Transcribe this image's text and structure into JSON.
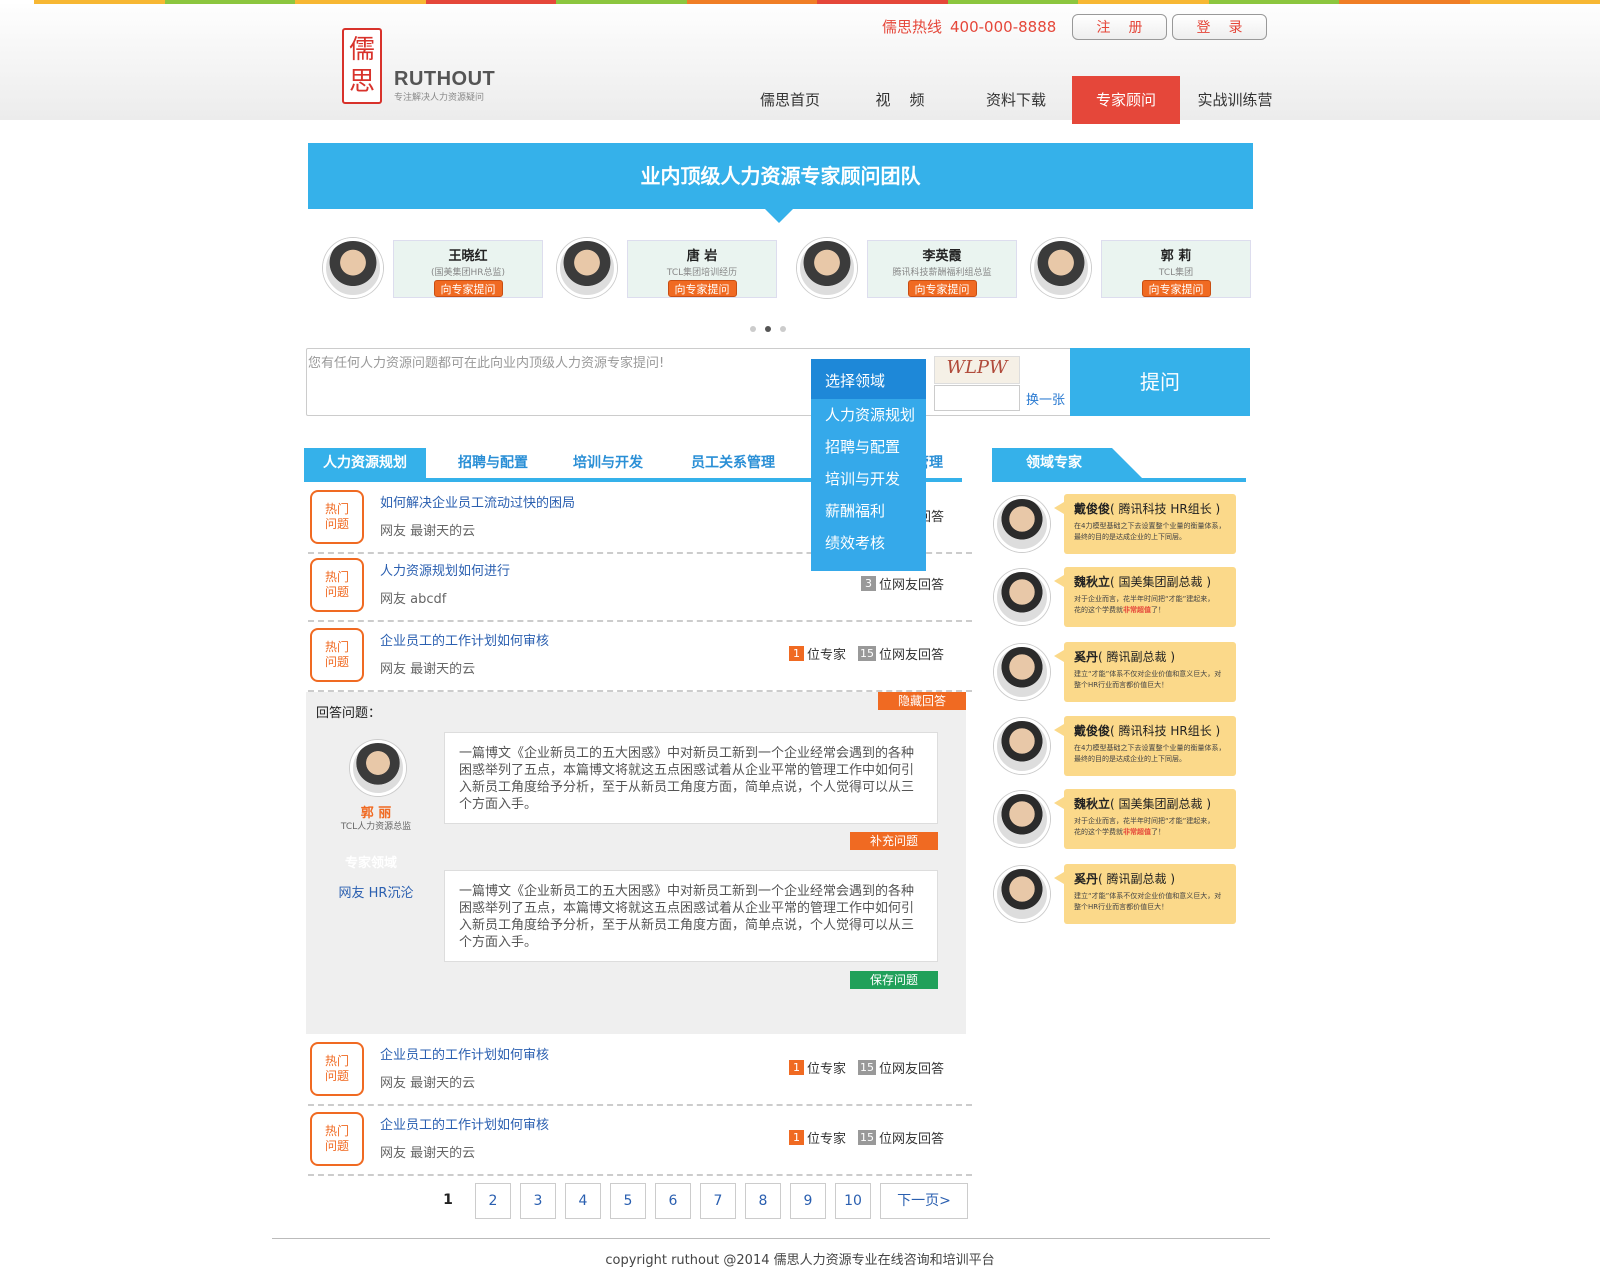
{
  "stripe_colors": [
    "#f7b733",
    "#8cc63f",
    "#f7b733",
    "#e5473a",
    "#8cc63f",
    "#f07e26",
    "#e5473a",
    "#8cc63f",
    "#f7b733",
    "#8cc63f",
    "#f07e26",
    "#f7b733"
  ],
  "header": {
    "logo_glyph_1": "儒",
    "logo_glyph_2": "思",
    "logo_text": "RUTHOUT",
    "logo_sub": "专注解决人力资源疑问",
    "hotline_label": "儒思热线",
    "hotline_number": "400-000-8888",
    "register": "注册",
    "login": "登录"
  },
  "nav": [
    {
      "label": "儒思首页",
      "active": false
    },
    {
      "label": "视    频",
      "active": false
    },
    {
      "label": "资料下载",
      "active": false
    },
    {
      "label": "专家顾问",
      "active": true
    },
    {
      "label": "实战训练营",
      "active": false
    }
  ],
  "banner": {
    "title": "业内顶级人力资源专家顾问团队"
  },
  "experts_top": [
    {
      "name": "王晓红",
      "title": "(国美集团HR总监)",
      "button": "向专家提问"
    },
    {
      "name": "唐 岩",
      "title": "TCL集团培训经历",
      "button": "向专家提问"
    },
    {
      "name": "李英霞",
      "title": "腾讯科技薪酬福利组总监",
      "button": "向专家提问"
    },
    {
      "name": "郭 莉",
      "title": "TCL集团",
      "button": "向专家提问"
    }
  ],
  "ask": {
    "placeholder": "您有任何人力资源问题都可在此向业内顶级人力资源专家提问!",
    "captcha_text": "WLPW",
    "refresh": "换一张",
    "submit": "提问"
  },
  "dropdown": {
    "head": "选择领域",
    "options": [
      "人力资源规划",
      "招聘与配置",
      "培训与开发",
      "薪酬福利",
      "绩效考核"
    ]
  },
  "tabs": [
    "人力资源规划",
    "招聘与配置",
    "培训与开发",
    "员工关系管理",
    "绩效管理"
  ],
  "right_tab": "领域专家",
  "hot_label_1": "热门",
  "hot_label_2": "问题",
  "questions_top": [
    {
      "title": "如何解决企业员工流动过快的困局",
      "user": "网友 最谢天的云",
      "experts": "",
      "expert_label": "",
      "answers": "",
      "answer_label": "友回答"
    },
    {
      "title": "人力资源规划如何进行",
      "user": "网友 abcdf",
      "experts": "",
      "expert_label": "",
      "answers": "3",
      "answer_label": "位网友回答"
    },
    {
      "title": "企业员工的工作计划如何审核",
      "user": "网友 最谢天的云",
      "experts": "1",
      "expert_label": "位专家",
      "answers": "15",
      "answer_label": "位网友回答"
    }
  ],
  "answer_panel": {
    "title": "回答问题：",
    "hide": "隐藏回答",
    "expert_name": "郭 丽",
    "expert_role": "TCL人力资源总监",
    "field_label": "专家领域",
    "user": "网友 HR沉沦",
    "text_1": "一篇博文《企业新员工的五大困惑》中对新员工新到一个企业经常会遇到的各种困惑举列了五点，本篇博文将就这五点困惑试着从企业平常的管理工作中如何引入新员工角度给予分析，至于从新员工角度方面，简单点说，个人觉得可以从三个方面入手。",
    "supplement": "补充问题",
    "text_2": "一篇博文《企业新员工的五大困惑》中对新员工新到一个企业经常会遇到的各种困惑举列了五点，本篇博文将就这五点困惑试着从企业平常的管理工作中如何引入新员工角度给予分析，至于从新员工角度方面，简单点说，个人觉得可以从三个方面入手。",
    "save": "保存问题"
  },
  "questions_bottom": [
    {
      "title": "企业员工的工作计划如何审核",
      "user": "网友 最谢天的云",
      "experts": "1",
      "expert_label": "位专家",
      "answers": "15",
      "answer_label": "位网友回答"
    },
    {
      "title": "企业员工的工作计划如何审核",
      "user": "网友 最谢天的云",
      "experts": "1",
      "expert_label": "位专家",
      "answers": "15",
      "answer_label": "位网友回答"
    }
  ],
  "right_experts": [
    {
      "name": "戴俊俊",
      "role": "( 腾讯科技 HR组长 )",
      "desc_1": "在4力模型基础之下去设置整个业量的衡量体系，",
      "desc_2": "最终的目的是达成企业的上下同层。",
      "highlight": "",
      "tail": ""
    },
    {
      "name": "魏秋立",
      "role": "( 国美集团副总裁 )",
      "desc_1": "对于企业而言，花半年时间把“才能”建起来，",
      "desc_2": "花的这个学费就",
      "highlight": "非常超值",
      "tail": "了！"
    },
    {
      "name": "奚丹",
      "role": "( 腾讯副总裁 )",
      "desc_1": "建立“才能”体系不仅对企业价值和意义巨大，对",
      "desc_2": "整个HR行业而言都价值巨大！",
      "highlight": "",
      "tail": ""
    },
    {
      "name": "戴俊俊",
      "role": "( 腾讯科技 HR组长 )",
      "desc_1": "在4力模型基础之下去设置整个业量的衡量体系，",
      "desc_2": "最终的目的是达成企业的上下同层。",
      "highlight": "",
      "tail": ""
    },
    {
      "name": "魏秋立",
      "role": "( 国美集团副总裁 )",
      "desc_1": "对于企业而言，花半年时间把“才能”建起来，",
      "desc_2": "花的这个学费就",
      "highlight": "非常超值",
      "tail": "了！"
    },
    {
      "name": "奚丹",
      "role": "( 腾讯副总裁 )",
      "desc_1": "建立“才能”体系不仅对企业价值和意义巨大，对",
      "desc_2": "整个HR行业而言都价值巨大！",
      "highlight": "",
      "tail": ""
    }
  ],
  "pager": {
    "pages": [
      "1",
      "2",
      "3",
      "4",
      "5",
      "6",
      "7",
      "8",
      "9",
      "10"
    ],
    "next": "下一页>"
  },
  "footer": "copyright ruthout @2014 儒思人力资源专业在线咨询和培训平台"
}
